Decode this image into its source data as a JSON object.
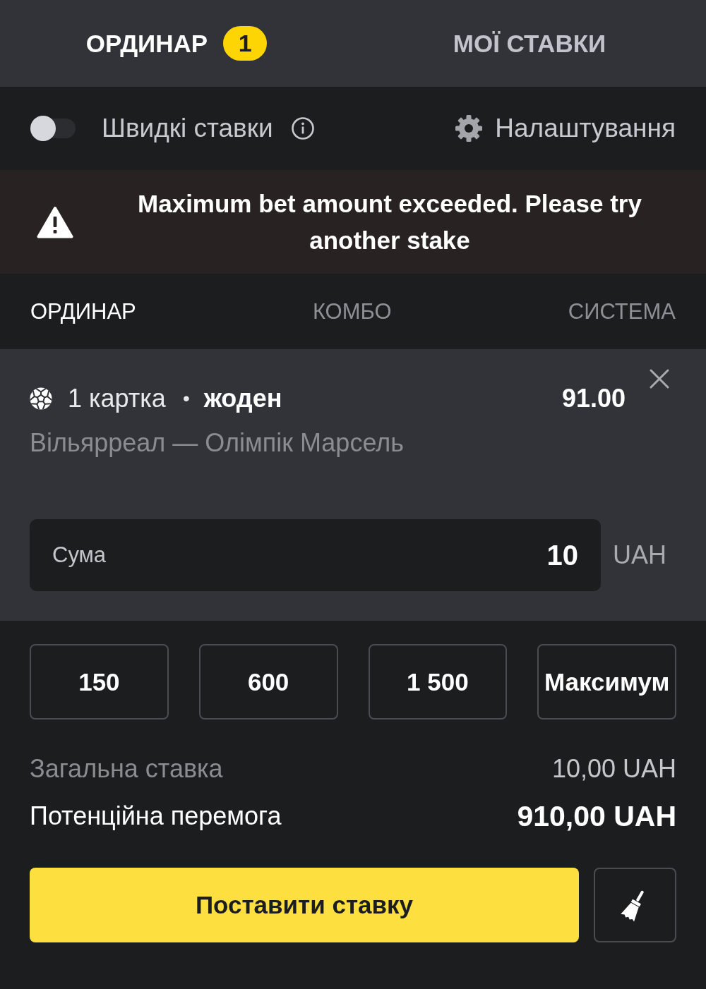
{
  "header_tabs": [
    {
      "label": "ОРДИНАР",
      "badge": "1",
      "selected": true
    },
    {
      "label": "МОЇ СТАВКИ",
      "selected": false
    }
  ],
  "quick_bets": {
    "label": "Швидкі ставки",
    "on": false
  },
  "settings": {
    "label": "Налаштування"
  },
  "alert": {
    "kind": "warning",
    "message": "Maximum bet amount exceeded. Please try another stake"
  },
  "bet_type_tabs": [
    {
      "label": "ОРДИНАР",
      "selected": true
    },
    {
      "label": "КОМБО",
      "selected": false
    },
    {
      "label": "СИСТЕМА",
      "selected": false
    }
  ],
  "bet": {
    "market": "1 картка",
    "separator": "•",
    "outcome": "жоден",
    "odds": "91.00",
    "match": "Вільярреал — Олімпік Марсель"
  },
  "stake": {
    "label": "Сума",
    "value": "10",
    "currency": "UAH"
  },
  "quick_amounts": [
    "150",
    "600",
    "1 500",
    "Максимум"
  ],
  "summary": [
    {
      "kind": "total",
      "label": "Загальна ставка",
      "value": "10,00 UAH"
    },
    {
      "kind": "win",
      "label": "Потенційна перемога",
      "value": "910,00 UAH"
    }
  ],
  "place_bet_button": "Поставити ставку"
}
